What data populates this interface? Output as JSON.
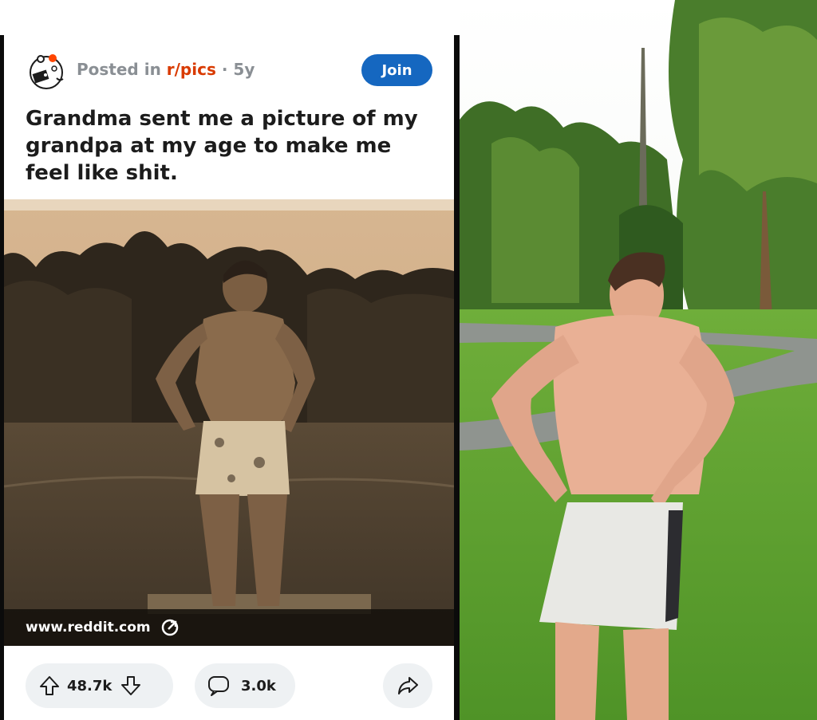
{
  "post": {
    "posted_in_prefix": "Posted in ",
    "subreddit": "r/pics",
    "separator": " · ",
    "age": "5y",
    "join_label": "Join",
    "title": "Grandma sent me a picture of my grandpa at my age to make me feel like shit.",
    "link_domain": "www.reddit.com",
    "upvotes": "48.7k",
    "comments": "3.0k"
  },
  "icons": {
    "avatar": "snoo-avatar-icon",
    "external_link": "external-link-icon",
    "upvote": "upvote-arrow-icon",
    "downvote": "downvote-arrow-icon",
    "comment": "comment-bubble-icon",
    "share": "share-arrow-icon"
  },
  "colors": {
    "subreddit": "#d93a00",
    "join_button": "#1567c0",
    "meta_text": "#8a8f94",
    "pill_background": "#eef1f3"
  }
}
